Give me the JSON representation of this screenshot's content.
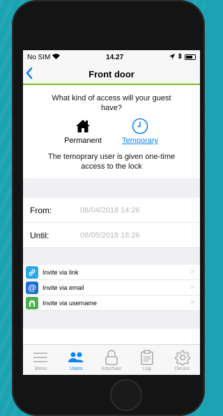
{
  "status_bar": {
    "carrier": "No SIM",
    "time": "14.27",
    "icons": [
      "wifi-icon",
      "location-icon",
      "bluetooth-icon",
      "battery-icon"
    ]
  },
  "nav": {
    "title": "Front door",
    "back_icon": "chevron-left-icon"
  },
  "access": {
    "question": "What kind of access will your guest have?",
    "options": [
      {
        "label": "Permanent",
        "icon": "house-icon",
        "selected": false
      },
      {
        "label": "Temporary",
        "icon": "clock-icon",
        "selected": true
      }
    ],
    "description": "The temoprary user is given one-time access to the lock"
  },
  "dates": {
    "from_label": "From:",
    "from_value": "08/04/2018 14:26",
    "until_label": "Until:",
    "until_value": "08/05/2018 18:26"
  },
  "invites": [
    {
      "label": "Invite via link",
      "icon": "link-icon",
      "color": "#2fa8e8"
    },
    {
      "label": "Invite via email",
      "icon": "at-sign-icon",
      "color": "#1f6fd6"
    },
    {
      "label": "Invite via username",
      "icon": "person-icon",
      "color": "#4caf50"
    }
  ],
  "tabs": [
    {
      "label": "Menu",
      "icon": "menu-icon",
      "active": false
    },
    {
      "label": "Users",
      "icon": "users-icon",
      "active": true
    },
    {
      "label": "Keychain",
      "icon": "lock-icon",
      "active": false
    },
    {
      "label": "Log",
      "icon": "clipboard-icon",
      "active": false
    },
    {
      "label": "Device",
      "icon": "gear-icon",
      "active": false
    }
  ],
  "colors": {
    "accent": "#0d84f2",
    "nav_underline": "#7ab51d",
    "background": "#1ba3b3"
  }
}
